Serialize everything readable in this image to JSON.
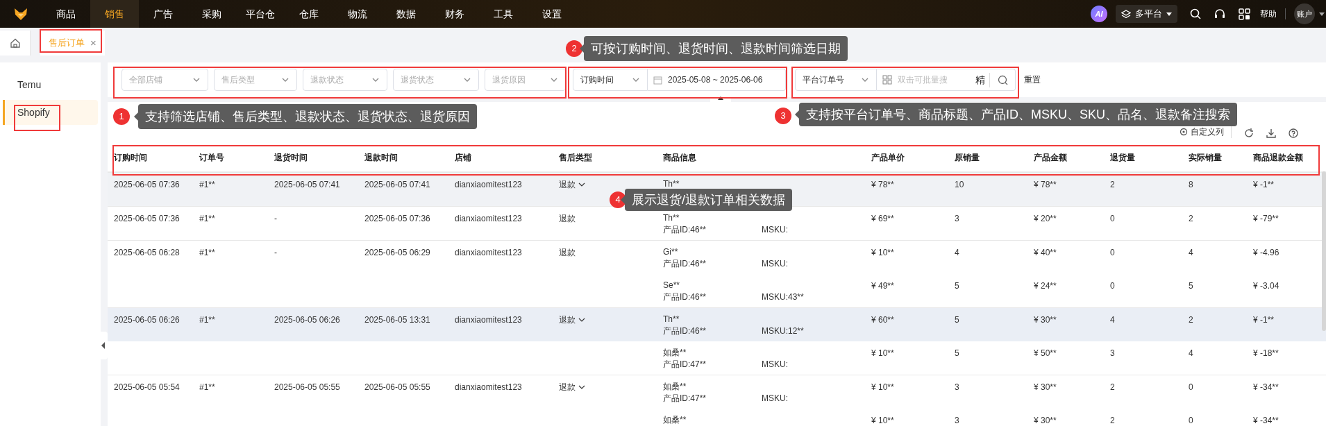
{
  "nav": {
    "items": [
      {
        "label": "商品",
        "selected": false
      },
      {
        "label": "销售",
        "selected": true
      },
      {
        "label": "广告",
        "selected": false
      },
      {
        "label": "采购",
        "selected": false
      },
      {
        "label": "平台仓",
        "selected": false
      },
      {
        "label": "仓库",
        "selected": false
      },
      {
        "label": "物流",
        "selected": false
      },
      {
        "label": "数据",
        "selected": false
      },
      {
        "label": "财务",
        "selected": false
      },
      {
        "label": "工具",
        "selected": false
      },
      {
        "label": "设置",
        "selected": false
      }
    ],
    "ai_badge": "AI",
    "platform_switch": {
      "label": "多平台",
      "expanded": false
    },
    "help": "帮助",
    "account": "账户"
  },
  "tabs": [
    {
      "label": "售后订单",
      "selected": true,
      "closable": "×"
    }
  ],
  "sidebar": {
    "items": [
      {
        "label": "Temu",
        "selected": false
      },
      {
        "label": "Shopify",
        "selected": true
      }
    ]
  },
  "filters": {
    "selects": [
      "全部店铺",
      "售后类型",
      "退款状态",
      "退货状态",
      "退货原因"
    ],
    "date_type": "订购时间",
    "date_range": "2025-05-08 ~ 2025-06-06",
    "search_type": "平台订单号",
    "search_placeholder": "双击可批量搜",
    "exact": "精",
    "reset": "重置"
  },
  "toolbar": {
    "columns_button": "自定义列"
  },
  "table": {
    "columns": [
      "订购时间",
      "订单号",
      "退货时间",
      "退款时间",
      "店铺",
      "售后类型",
      "商品信息",
      "产品单价",
      "原销量",
      "产品金额",
      "退货量",
      "实际销量",
      "商品退款金额"
    ],
    "rows": [
      {
        "order_time": "2025-06-05 07:36",
        "order_no": "#1**",
        "return_time": "2025-06-05 07:41",
        "refund_time": "2025-06-05 07:41",
        "store": "dianxiaomitest123",
        "type": "退款",
        "expandable": true,
        "products": [
          {
            "name": "Th**",
            "unit_price": "¥ 78**",
            "orig_qty": "10",
            "amount": "¥ 78**",
            "return_qty": "2",
            "actual_qty": "8",
            "refund": "¥ -1**",
            "highlighted": true
          }
        ]
      },
      {
        "order_time": "2025-06-05 07:36",
        "order_no": "#1**",
        "return_time": "-",
        "refund_time": "2025-06-05 07:36",
        "store": "dianxiaomitest123",
        "type": "退款",
        "expandable": false,
        "products": [
          {
            "name": "Th**",
            "product_id": "产品ID:46**",
            "msku": "MSKU:",
            "unit_price": "¥ 69**",
            "orig_qty": "3",
            "amount": "¥ 20**",
            "return_qty": "0",
            "actual_qty": "2",
            "refund": "¥ -79**",
            "highlighted": false
          }
        ]
      },
      {
        "order_time": "2025-06-05 06:28",
        "order_no": "#1**",
        "return_time": "-",
        "refund_time": "2025-06-05 06:29",
        "store": "dianxiaomitest123",
        "type": "退款",
        "expandable": false,
        "products": [
          {
            "name": "Gi**",
            "product_id": "产品ID:46**",
            "msku": "MSKU:",
            "unit_price": "¥ 10**",
            "orig_qty": "4",
            "amount": "¥ 40**",
            "return_qty": "0",
            "actual_qty": "4",
            "refund": "¥ -4.96",
            "highlighted": false
          },
          {
            "name": "Se**",
            "product_id": "产品ID:46**",
            "msku": "MSKU:43**",
            "unit_price": "¥ 49**",
            "orig_qty": "5",
            "amount": "¥ 24**",
            "return_qty": "0",
            "actual_qty": "5",
            "refund": "¥ -3.04",
            "highlighted": false
          }
        ]
      },
      {
        "order_time": "2025-06-05 06:26",
        "order_no": "#1**",
        "return_time": "2025-06-05 06:26",
        "refund_time": "2025-06-05 13:31",
        "store": "dianxiaomitest123",
        "type": "退款",
        "expandable": true,
        "products": [
          {
            "name": "Th**",
            "product_id": "产品ID:46**",
            "msku": "MSKU:12**",
            "unit_price": "¥ 60**",
            "orig_qty": "5",
            "amount": "¥ 30**",
            "return_qty": "4",
            "actual_qty": "2",
            "refund": "¥ -1**",
            "highlighted": true
          },
          {
            "name": "如桑**",
            "product_id": "产品ID:47**",
            "msku": "MSKU:",
            "unit_price": "¥ 10**",
            "orig_qty": "5",
            "amount": "¥ 50**",
            "return_qty": "3",
            "actual_qty": "4",
            "refund": "¥ -18**",
            "highlighted": false
          }
        ]
      },
      {
        "order_time": "2025-06-05 05:54",
        "order_no": "#1**",
        "return_time": "2025-06-05 05:55",
        "refund_time": "2025-06-05 05:55",
        "store": "dianxiaomitest123",
        "type": "退款",
        "expandable": true,
        "products": [
          {
            "name": "如桑**",
            "product_id": "产品ID:47**",
            "msku": "MSKU:",
            "unit_price": "¥ 10**",
            "orig_qty": "3",
            "amount": "¥ 30**",
            "return_qty": "2",
            "actual_qty": "0",
            "refund": "¥ -34**",
            "highlighted": false
          },
          {
            "name": "如桑**",
            "unit_price": "¥ 10**",
            "orig_qty": "3",
            "amount": "¥ 30**",
            "return_qty": "2",
            "actual_qty": "0",
            "refund": "¥ -34**",
            "highlighted": false
          }
        ]
      }
    ]
  },
  "annotations": [
    {
      "number": "2",
      "text": "可按订购时间、退货时间、退款时间筛选日期"
    },
    {
      "number": "1",
      "text": "支持筛选店铺、售后类型、退款状态、退货状态、退货原因"
    },
    {
      "number": "3",
      "text": "支持按平台订单号、商品标题、产品ID、MSKU、SKU、品名、退款备注搜索"
    },
    {
      "number": "4",
      "text": "展示退货/退款订单相关数据"
    }
  ]
}
